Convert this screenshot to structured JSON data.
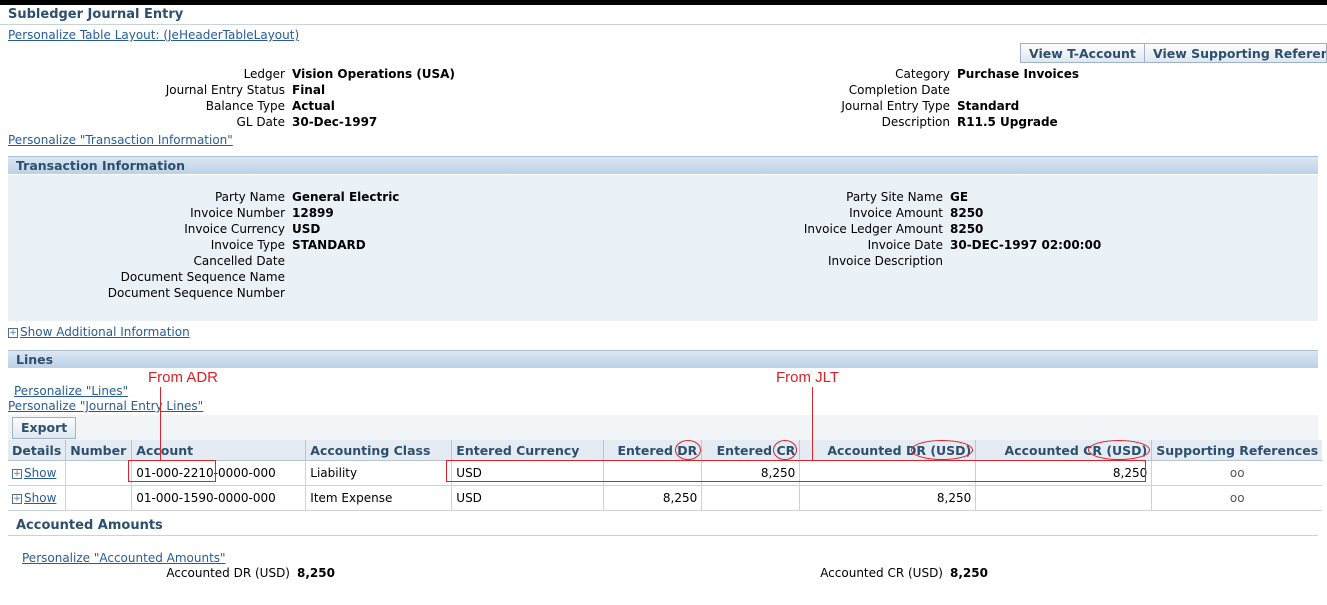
{
  "page": {
    "title": "Subledger Journal Entry",
    "personalize_table_layout": "Personalize Table Layout: (JeHeaderTableLayout)",
    "buttons": {
      "view_t_account": "View T-Account",
      "view_supporting_references": "View Supporting References"
    }
  },
  "header": {
    "left": [
      {
        "label": "Ledger",
        "value": "Vision Operations (USA)"
      },
      {
        "label": "Journal Entry Status",
        "value": "Final"
      },
      {
        "label": "Balance Type",
        "value": "Actual"
      },
      {
        "label": "GL Date",
        "value": "30-Dec-1997"
      }
    ],
    "right": [
      {
        "label": "Category",
        "value": "Purchase Invoices"
      },
      {
        "label": "Completion Date",
        "value": ""
      },
      {
        "label": "Journal Entry Type",
        "value": "Standard"
      },
      {
        "label": "Description",
        "value": "R11.5 Upgrade"
      }
    ],
    "personalize_transaction": "Personalize \"Transaction Information\""
  },
  "transaction": {
    "section_title": "Transaction Information",
    "left": [
      {
        "label": "Party Name",
        "value": "General Electric"
      },
      {
        "label": "Invoice Number",
        "value": "12899"
      },
      {
        "label": "Invoice Currency",
        "value": "USD"
      },
      {
        "label": "Invoice Type",
        "value": "STANDARD"
      },
      {
        "label": "Cancelled Date",
        "value": ""
      },
      {
        "label": "Document Sequence Name",
        "value": ""
      },
      {
        "label": "Document Sequence Number",
        "value": ""
      }
    ],
    "right": [
      {
        "label": "Party Site Name",
        "value": "GE"
      },
      {
        "label": "Invoice Amount",
        "value": "8250"
      },
      {
        "label": "Invoice Ledger Amount",
        "value": "8250"
      },
      {
        "label": "Invoice Date",
        "value": "30-DEC-1997 02:00:00"
      },
      {
        "label": "Invoice Description",
        "value": ""
      }
    ],
    "show_additional": "Show Additional Information"
  },
  "lines": {
    "section_title": "Lines",
    "personalize_lines": "Personalize \"Lines\"",
    "personalize_journal_lines": "Personalize \"Journal Entry Lines\"",
    "export_label": "Export",
    "annotation_adr": "From ADR",
    "annotation_jlt": "From JLT",
    "columns": [
      "Details",
      "Number",
      "Account",
      "Accounting Class",
      "Entered Currency",
      "Entered DR",
      "Entered CR",
      "Accounted DR (USD)",
      "Accounted CR (USD)",
      "Supporting References"
    ],
    "rows": [
      {
        "details": "Show",
        "number": "",
        "account": "01-000-2210-0000-000",
        "accounting_class": "Liability",
        "entered_currency": "USD",
        "entered_dr": "",
        "entered_cr": "8,250",
        "accounted_dr": "",
        "accounted_cr": "8,250",
        "supporting_ref": "oo"
      },
      {
        "details": "Show",
        "number": "",
        "account": "01-000-1590-0000-000",
        "accounting_class": "Item Expense",
        "entered_currency": "USD",
        "entered_dr": "8,250",
        "entered_cr": "",
        "accounted_dr": "8,250",
        "accounted_cr": "",
        "supporting_ref": "oo"
      }
    ]
  },
  "accounted_amounts": {
    "title": "Accounted Amounts",
    "personalize": "Personalize \"Accounted Amounts\"",
    "dr_label": "Accounted DR (USD)",
    "dr_value": "8,250",
    "cr_label": "Accounted CR (USD)",
    "cr_value": "8,250"
  },
  "colors": {
    "link": "#285c95",
    "header_text": "#2d4f6e",
    "annotation": "#d8232a",
    "panel_bg": "#eaf1f7"
  },
  "icons": {
    "expand": "plus-box-icon",
    "supporting_reference": "glasses-icon"
  }
}
